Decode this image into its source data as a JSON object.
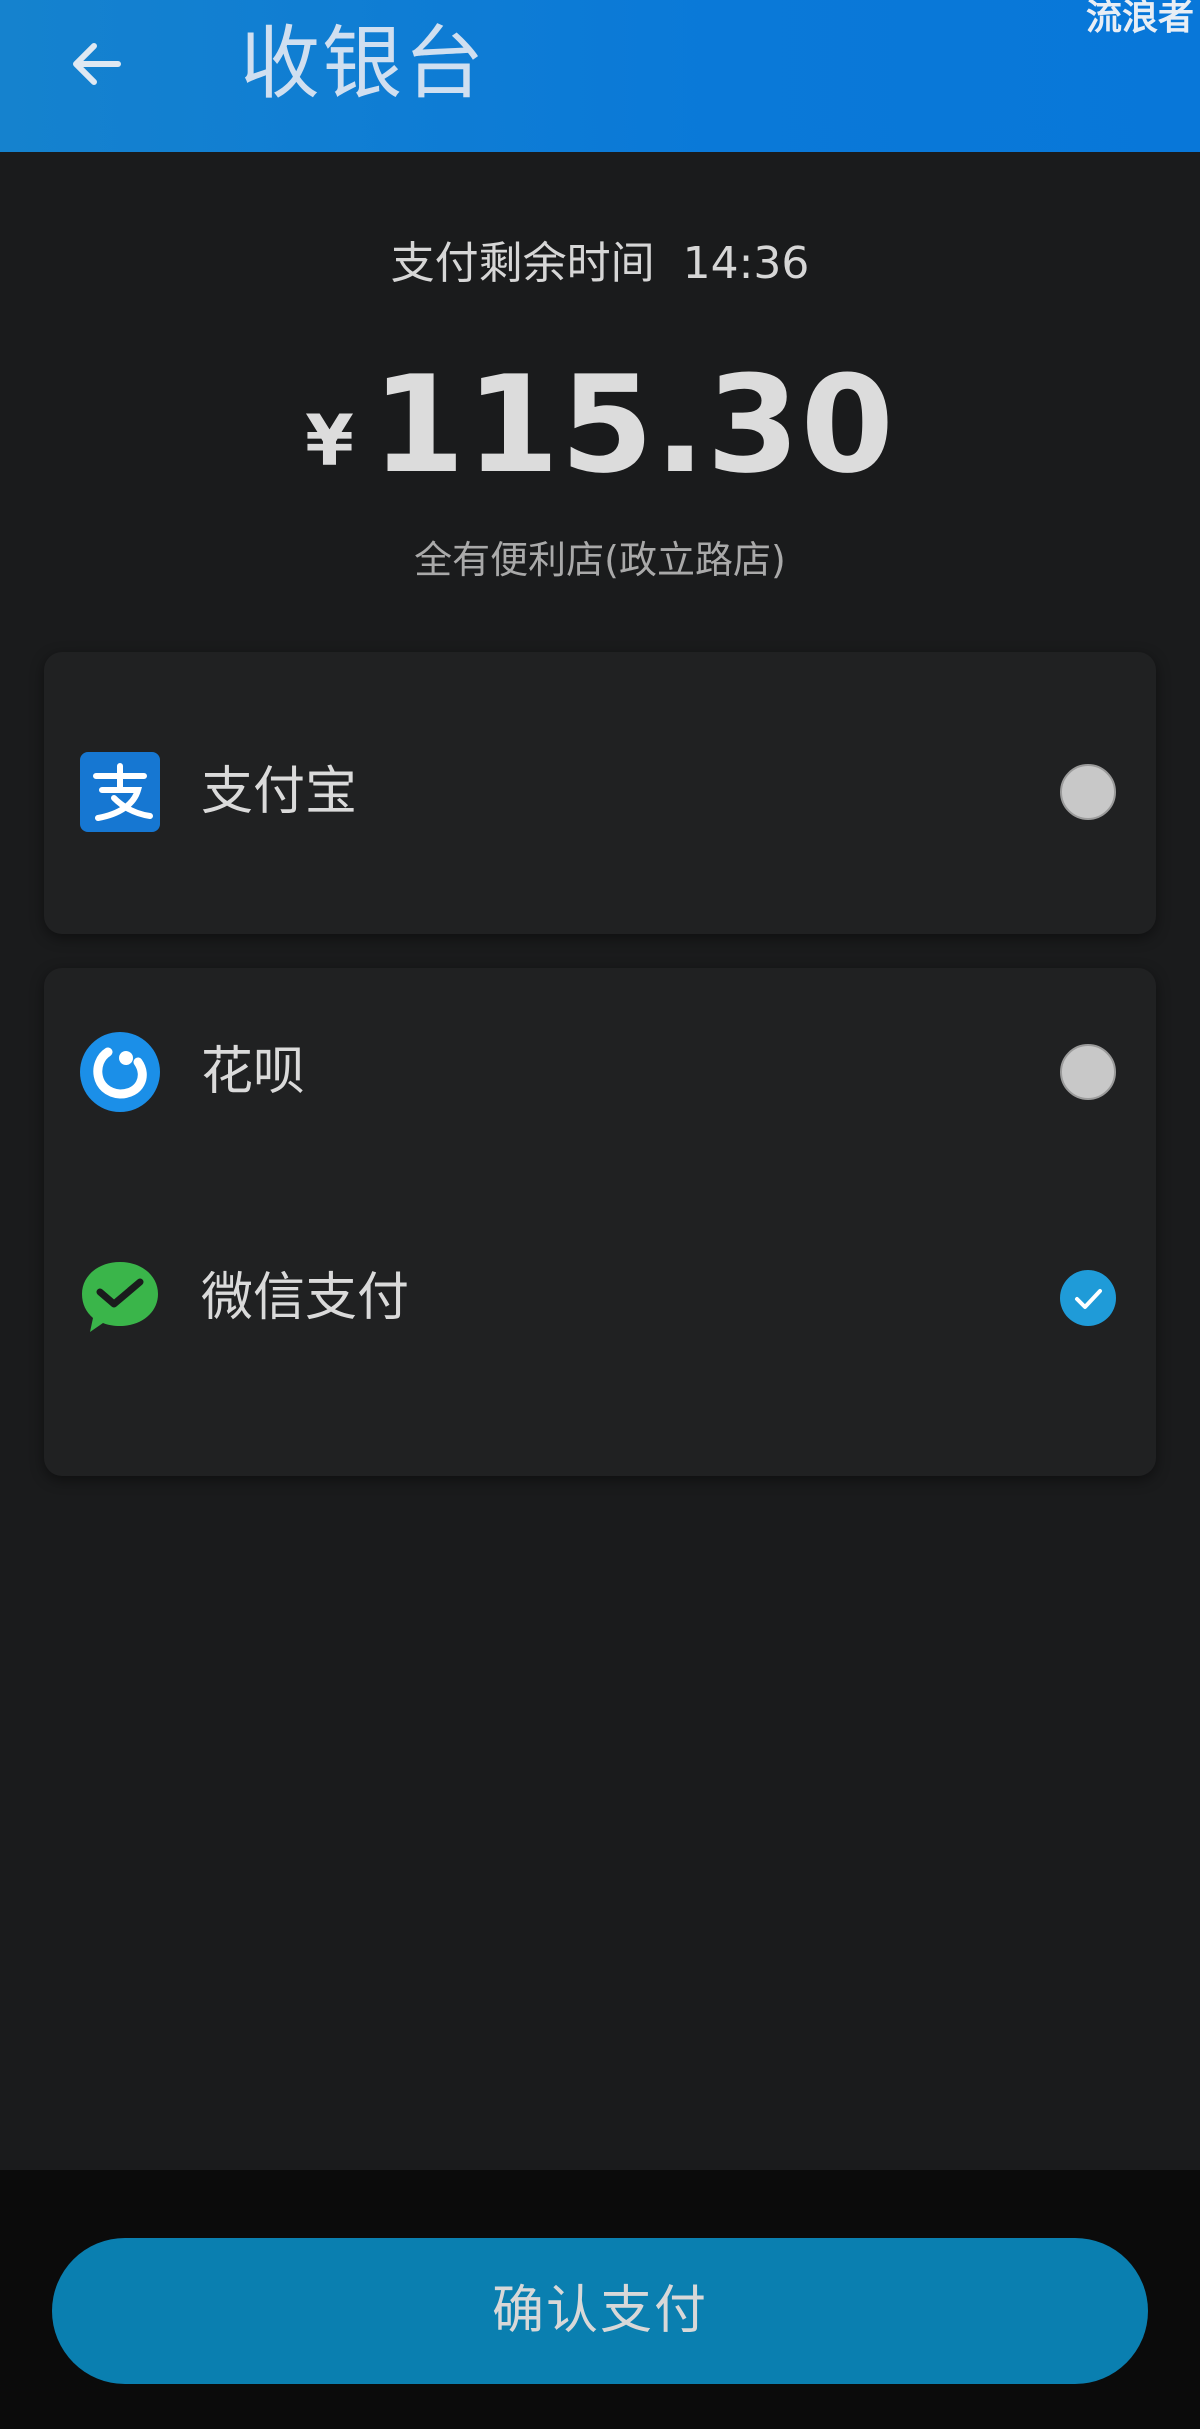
{
  "header": {
    "title": "收银台",
    "watermark": "流浪者"
  },
  "payment": {
    "timer_label": "支付剩余时间",
    "timer_value": "14:36",
    "currency_symbol": "¥",
    "amount": "115.30",
    "merchant": "全有便利店(政立路店)"
  },
  "methods": {
    "alipay": {
      "label": "支付宝",
      "icon": "alipay-icon",
      "selected": false
    },
    "huabei": {
      "label": "花呗",
      "icon": "huabei-icon",
      "selected": false
    },
    "wechat": {
      "label": "微信支付",
      "icon": "wechat-pay-icon",
      "selected": true
    }
  },
  "footer": {
    "confirm_label": "确认支付"
  },
  "colors": {
    "header_blue": "#0a79d8",
    "background": "#1a1b1c",
    "card": "#202122",
    "selected": "#1f9bd8",
    "confirm_button": "#0a7fb0"
  }
}
